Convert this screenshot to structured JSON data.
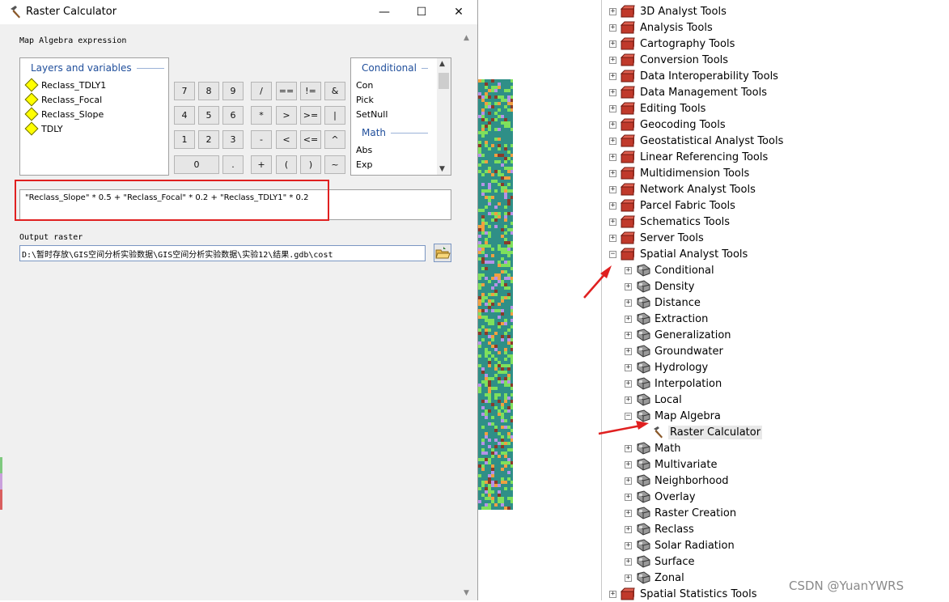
{
  "dialog": {
    "title": "Raster Calculator",
    "window_controls": {
      "minimize": "—",
      "maximize": "☐",
      "close": "✕"
    },
    "expression_label": "Map Algebra expression",
    "layers_header": "Layers and variables",
    "layers": [
      "Reclass_TDLY1",
      "Reclass_Focal",
      "Reclass_Slope",
      "TDLY"
    ],
    "keypad": {
      "k7": "7",
      "k8": "8",
      "k9": "9",
      "div": "/",
      "eq": "==",
      "ne": "!=",
      "and": "&",
      "k4": "4",
      "k5": "5",
      "k6": "6",
      "mul": "*",
      "gt": ">",
      "ge": ">=",
      "or": "|",
      "k1": "1",
      "k2": "2",
      "k3": "3",
      "sub": "-",
      "lt": "<",
      "le": "<=",
      "xor": "^",
      "k0": "0",
      "dot": ".",
      "add": "+",
      "lparen": "(",
      "rparen": ")",
      "not": "~"
    },
    "functions": {
      "conditional_header": "Conditional",
      "conditional_items": [
        "Con",
        "Pick",
        "SetNull"
      ],
      "math_header": "Math",
      "math_items": [
        "Abs",
        "Exp"
      ]
    },
    "expression": "\"Reclass_Slope\" * 0.5 + \"Reclass_Focal\" * 0.2 + \"Reclass_TDLY1\" * 0.2",
    "output_label": "Output raster",
    "output_value": "D:\\暂时存放\\GIS空间分析实验数据\\GIS空间分析实验数据\\实验12\\结果.gdb\\cost",
    "highlight_color": "#e02020"
  },
  "toolbox_tree": {
    "toolboxes_top": [
      "3D Analyst Tools",
      "Analysis Tools",
      "Cartography Tools",
      "Conversion Tools",
      "Data Interoperability Tools",
      "Data Management Tools",
      "Editing Tools",
      "Geocoding Tools",
      "Geostatistical Analyst Tools",
      "Linear Referencing Tools",
      "Multidimension Tools",
      "Network Analyst Tools",
      "Parcel Fabric Tools",
      "Schematics Tools",
      "Server Tools"
    ],
    "expanded_toolbox": "Spatial Analyst Tools",
    "toolsets_before": [
      "Conditional",
      "Density",
      "Distance",
      "Extraction",
      "Generalization",
      "Groundwater",
      "Hydrology",
      "Interpolation",
      "Local"
    ],
    "expanded_toolset": "Map Algebra",
    "selected_tool": "Raster Calculator",
    "toolsets_after": [
      "Math",
      "Multivariate",
      "Neighborhood",
      "Overlay",
      "Raster Creation",
      "Reclass",
      "Solar Radiation",
      "Surface",
      "Zonal"
    ],
    "toolboxes_bottom": [
      "Spatial Statistics Tools"
    ],
    "expander_plus": "+",
    "expander_minus": "−",
    "arrow_color": "#e02020"
  },
  "watermark": "CSDN @YuanYWRS"
}
